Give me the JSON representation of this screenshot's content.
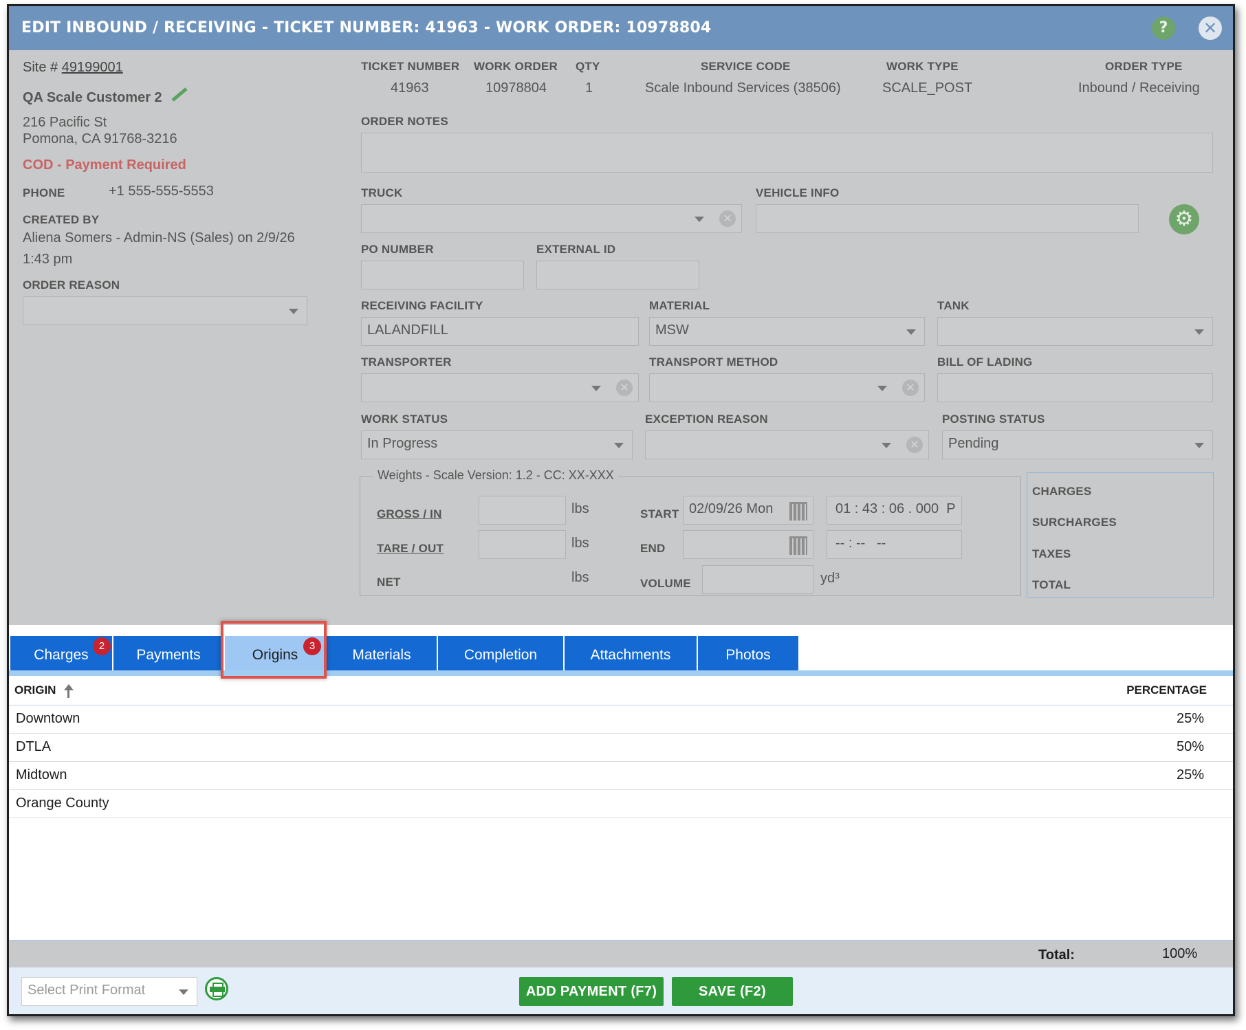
{
  "dialog": {
    "title": "EDIT INBOUND / RECEIVING - TICKET NUMBER: 41963 - WORK ORDER: 10978804",
    "help_label": "?",
    "close_label": "✕"
  },
  "customer": {
    "site_prefix": "Site #",
    "site_number": "49199001",
    "name": "QA Scale Customer 2",
    "address1": "216 Pacific St",
    "address2": "Pomona, CA 91768-3216",
    "payment_terms": "COD - Payment Required",
    "phone_label": "PHONE",
    "phone": "+1 555-555-5553",
    "created_by_label": "CREATED BY",
    "created_by_line1": "Aliena Somers - Admin-NS (Sales) on 2/9/26",
    "created_by_line2": "1:43 pm",
    "order_reason_label": "ORDER REASON",
    "order_reason_value": ""
  },
  "summary": {
    "ticket_number_label": "TICKET NUMBER",
    "ticket_number": "41963",
    "work_order_label": "WORK ORDER",
    "work_order": "10978804",
    "qty_label": "QTY",
    "qty": "1",
    "service_code_label": "SERVICE CODE",
    "service_code": "Scale Inbound Services (38506)",
    "work_type_label": "WORK TYPE",
    "work_type": "SCALE_POST",
    "order_type_label": "ORDER TYPE",
    "order_type": "Inbound / Receiving"
  },
  "form": {
    "order_notes_label": "ORDER NOTES",
    "order_notes": "",
    "truck_label": "TRUCK",
    "truck": "",
    "vehicle_info_label": "VEHICLE INFO",
    "vehicle_info": "",
    "po_number_label": "PO NUMBER",
    "po_number": "",
    "external_id_label": "EXTERNAL ID",
    "external_id": "",
    "receiving_facility_label": "RECEIVING FACILITY",
    "receiving_facility": "LALANDFILL",
    "material_label": "MATERIAL",
    "material": "MSW",
    "tank_label": "TANK",
    "tank": "",
    "transporter_label": "TRANSPORTER",
    "transporter": "",
    "transport_method_label": "TRANSPORT METHOD",
    "transport_method": "",
    "bill_of_lading_label": "BILL OF LADING",
    "bill_of_lading": "",
    "work_status_label": "WORK STATUS",
    "work_status": "In Progress",
    "exception_reason_label": "EXCEPTION REASON",
    "exception_reason": "",
    "posting_status_label": "POSTING STATUS",
    "posting_status": "Pending"
  },
  "weights": {
    "legend": "Weights - Scale Version: 1.2 - CC: XX-XXX",
    "gross_label": "GROSS / IN",
    "tare_label": "TARE / OUT",
    "net_label": "NET",
    "unit": "lbs",
    "start_label": "START",
    "start_date": "02/09/26 Mon",
    "start_time": "01 : 43 : 06 . 000  P",
    "end_label": "END",
    "end_date": "",
    "end_time": "-- : --   --",
    "volume_label": "VOLUME",
    "volume_unit": "yd³"
  },
  "totals_panel": {
    "charges": "CHARGES",
    "surcharges": "SURCHARGES",
    "taxes": "TAXES",
    "total": "TOTAL"
  },
  "tabs": [
    {
      "label": "Charges",
      "badge": "2"
    },
    {
      "label": "Payments"
    },
    {
      "label": "Origins",
      "badge": "3",
      "active": true
    },
    {
      "label": "Materials"
    },
    {
      "label": "Completion"
    },
    {
      "label": "Attachments"
    },
    {
      "label": "Photos"
    }
  ],
  "origins_table": {
    "col_origin": "ORIGIN",
    "col_percentage": "PERCENTAGE",
    "rows": [
      {
        "origin": "Downtown",
        "percentage": "25%"
      },
      {
        "origin": "DTLA",
        "percentage": "50%"
      },
      {
        "origin": "Midtown",
        "percentage": "25%"
      },
      {
        "origin": "Orange County",
        "percentage": ""
      }
    ],
    "total_label": "Total:",
    "total_value": "100%"
  },
  "footer": {
    "print_format_placeholder": "Select Print Format",
    "add_payment": "ADD PAYMENT (F7)",
    "save": "SAVE (F2)"
  },
  "colors": {
    "titlebar": "#6e93bd",
    "tab_blue": "#1469d2",
    "tab_active": "#9ec8f3",
    "badge_red": "#c8232e",
    "green": "#2f9a3b",
    "cod_red": "#c86464"
  }
}
